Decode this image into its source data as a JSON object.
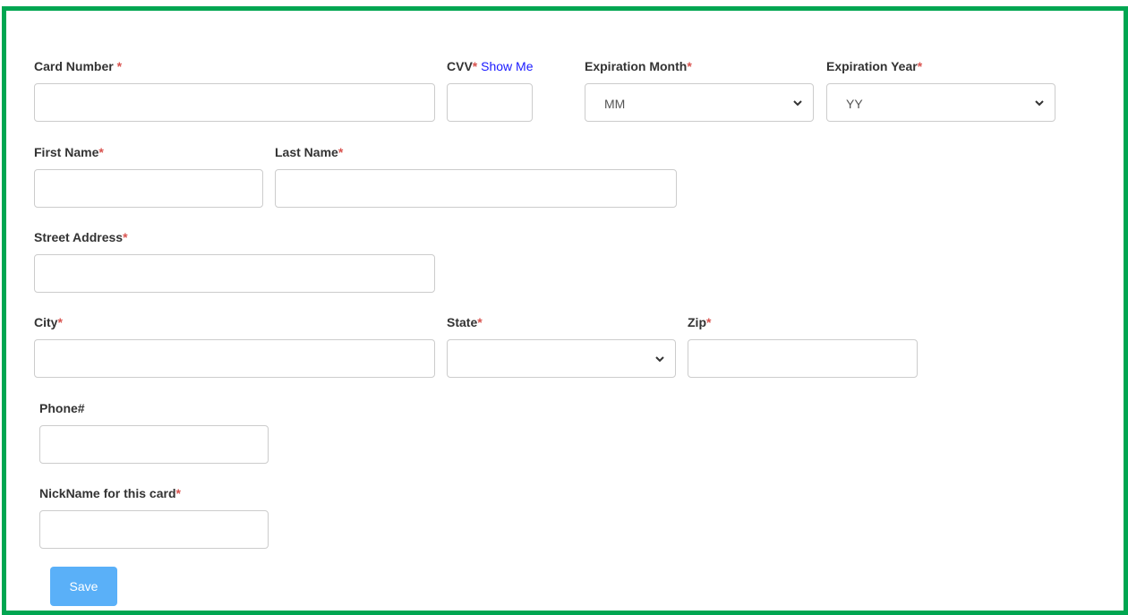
{
  "form": {
    "card_number": {
      "label": "Card Number ",
      "required": "*",
      "value": ""
    },
    "cvv": {
      "label": "CVV",
      "required": "*",
      "link": "Show Me",
      "value": ""
    },
    "expiration_month": {
      "label": "Expiration Month",
      "required": "*",
      "selected": "MM"
    },
    "expiration_year": {
      "label": "Expiration Year",
      "required": "*",
      "selected": "YY"
    },
    "first_name": {
      "label": "First Name",
      "required": "*",
      "value": ""
    },
    "last_name": {
      "label": "Last Name",
      "required": "*",
      "value": ""
    },
    "street_address": {
      "label": "Street Address",
      "required": "*",
      "value": ""
    },
    "city": {
      "label": "City",
      "required": "*",
      "value": ""
    },
    "state": {
      "label": "State",
      "required": "*",
      "selected": ""
    },
    "zip": {
      "label": "Zip",
      "required": "*",
      "value": ""
    },
    "phone": {
      "label": "Phone#",
      "value": ""
    },
    "nickname": {
      "label": "NickName for this card",
      "required": "*",
      "value": ""
    },
    "save_label": "Save"
  },
  "colors": {
    "frame_border": "#00a651",
    "required_asterisk": "#d9534f",
    "link": "#1a1aff",
    "save_button": "#5ab0f8"
  },
  "icons": {
    "select_arrow": "chevron-down-icon"
  }
}
